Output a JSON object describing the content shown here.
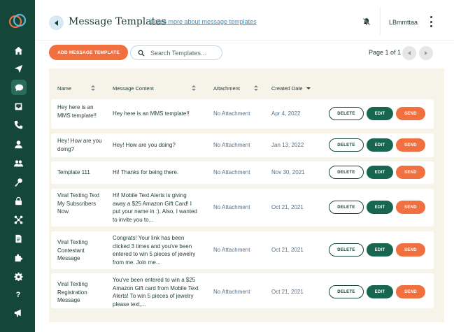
{
  "header": {
    "title": "Message Templates",
    "learn_link": "Learn more about message templates",
    "user_name": "LBmmttaa"
  },
  "toolbar": {
    "add_button": "ADD MESSAGE TEMPLATE",
    "search_placeholder": "Search Templates...",
    "search_value": "",
    "page_info": "Page 1 of 1"
  },
  "sidebar": {
    "items": [
      {
        "icon": "home-icon"
      },
      {
        "icon": "send-icon"
      },
      {
        "icon": "chat-bubble-icon",
        "active": true
      },
      {
        "icon": "inbox-icon"
      },
      {
        "icon": "phone-icon"
      },
      {
        "icon": "user-icon"
      },
      {
        "icon": "group-icon"
      },
      {
        "icon": "key-icon"
      },
      {
        "icon": "lock-icon"
      },
      {
        "icon": "network-icon"
      },
      {
        "icon": "document-icon"
      },
      {
        "icon": "puzzle-icon"
      },
      {
        "icon": "settings-icon"
      },
      {
        "icon": "help-icon",
        "text": "?"
      },
      {
        "icon": "megaphone-icon"
      }
    ]
  },
  "table": {
    "columns": [
      "Name",
      "Message Content",
      "Attachment",
      "Created Date"
    ],
    "action_labels": {
      "delete": "DELETE",
      "edit": "EDIT",
      "send": "SEND"
    },
    "rows": [
      {
        "name": "Hey here is an MMS template!!",
        "content": "Hey here is an MMS template!!",
        "attachment": "No Attachment",
        "date": "Apr 4, 2022"
      },
      {
        "name": "Hey! How are you doing?",
        "content": "Hey! How are you doing?",
        "attachment": "No Attachment",
        "date": "Jan 13, 2022"
      },
      {
        "name": "Template 111",
        "content": "Hi! Thanks for being there.",
        "attachment": "No Attachment",
        "date": "Nov 30, 2021"
      },
      {
        "name": "Viral Texting Text My Subscribers Now",
        "content": "Hi! Mobile Text Alerts is giving away a $25 Amazon Gift Card! I put your name in :). Also, I wanted to invite you to...",
        "attachment": "No Attachment",
        "date": "Oct 21, 2021"
      },
      {
        "name": "Viral Texting Contestant Message",
        "content": "Congrats! Your link has been clicked 3 times and you've been entered to win 5 pieces of jewelry from me. Join me...",
        "attachment": "No Attachment",
        "date": "Oct 21, 2021"
      },
      {
        "name": "Viral Texting Registration Message",
        "content": "You've been entered to win a $25 Amazon Gift card from Mobile Text Alerts! To win 5 pieces of jewelry please text,...",
        "attachment": "No Attachment",
        "date": "Oct 21, 2021"
      }
    ]
  }
}
